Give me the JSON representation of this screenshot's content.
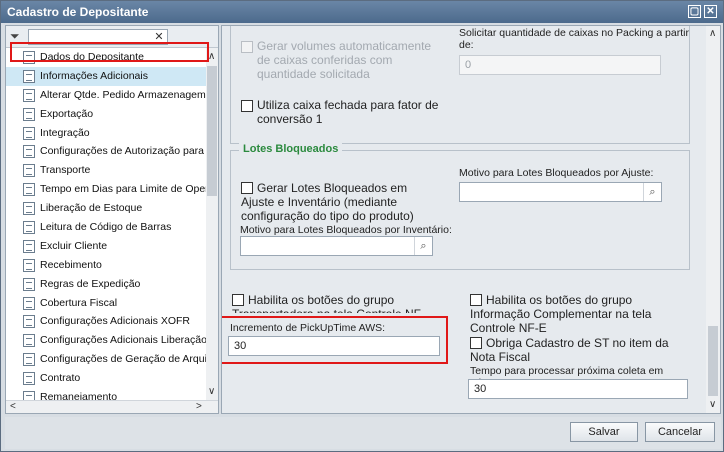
{
  "window": {
    "title": "Cadastro de Depositante",
    "restore_glyph": "▢",
    "close_glyph": "✕"
  },
  "sidebar": {
    "filter_value": "",
    "clear_glyph": "✕",
    "filter_glyph": "⏷",
    "items": [
      {
        "label": "Dados do Depositante"
      },
      {
        "label": "Informações Adicionais",
        "selected": true
      },
      {
        "label": "Alterar Qtde. Pedido Armazenagem"
      },
      {
        "label": "Exportação"
      },
      {
        "label": "Integração"
      },
      {
        "label": "Configurações de Autorização para B"
      },
      {
        "label": "Transporte"
      },
      {
        "label": "Tempo em Dias para Limite de Operaç"
      },
      {
        "label": "Liberação de Estoque"
      },
      {
        "label": "Leitura de Código de Barras"
      },
      {
        "label": "Excluir Cliente"
      },
      {
        "label": "Recebimento"
      },
      {
        "label": "Regras de Expedição"
      },
      {
        "label": "Cobertura Fiscal"
      },
      {
        "label": "Configurações Adicionais XOFR"
      },
      {
        "label": "Configurações Adicionais Liberação N"
      },
      {
        "label": "Configurações de Geração de Arquiv"
      },
      {
        "label": "Contrato"
      },
      {
        "label": "Remanejamento"
      }
    ],
    "scroll_up": "∧",
    "scroll_down": "∨",
    "scroll_left": "<",
    "scroll_right": ">"
  },
  "main": {
    "gerar_volumes_label": "Gerar volumes automaticamente de caixas conferidas com quantidade solicitada",
    "solicitar_label": "Solicitar quantidade de caixas no Packing a partir de:",
    "solicitar_value": "0",
    "utiliza_caixa_label": "Utiliza caixa fechada para fator de conversão 1",
    "lotes_legend": "Lotes Bloqueados",
    "gerar_lotes_label": "Gerar Lotes Bloqueados em Ajuste e Inventário (mediante configuração do tipo do produto)",
    "motivo_ajuste_label": "Motivo para Lotes Bloqueados por Ajuste:",
    "motivo_ajuste_value": "",
    "motivo_inventario_label": "Motivo para Lotes Bloqueados por Inventário:",
    "motivo_inventario_value": "",
    "habilita_transportadora_label": "Habilita os botões do grupo Transportadora na tela Controle NF-E",
    "habilita_informacao_label": "Habilita os botões do grupo Informação Complementar na tela Controle NF-E",
    "pickup_label": "Incremento de PickUpTime AWS:",
    "pickup_value": "30",
    "obriga_st_label": "Obriga Cadastro de ST no item da Nota Fiscal",
    "tempo_coleta_label": "Tempo para processar próxima coleta em minutos:",
    "tempo_coleta_value": "30",
    "search_glyph": "⌕",
    "scroll_up": "∧",
    "scroll_down": "∨"
  },
  "footer": {
    "save_label": "Salvar",
    "cancel_label": "Cancelar"
  }
}
